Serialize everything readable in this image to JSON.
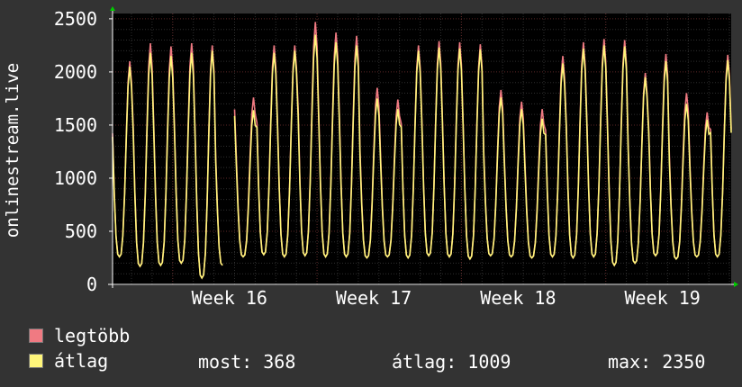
{
  "chart_data": {
    "type": "line",
    "ylabel": "onlinestream.live",
    "yticks": [
      0,
      500,
      1000,
      1500,
      2000,
      2500
    ],
    "ylim": [
      0,
      2550
    ],
    "week_ticks": [
      "Week 16",
      "Week 17",
      "Week 18",
      "Week 19"
    ],
    "x_hour_range": [
      0,
      720
    ],
    "days": 30,
    "daily_peaks_max": [
      2100,
      2270,
      2240,
      2270,
      2250,
      1820,
      1760,
      2250,
      2250,
      2470,
      2370,
      2340,
      1850,
      1740,
      2250,
      2290,
      2280,
      2260,
      1830,
      1720,
      1650,
      2150,
      2280,
      2310,
      2300,
      1990,
      2170,
      1800,
      1620,
      2160
    ],
    "daily_peaks_avg": [
      2050,
      2180,
      2150,
      2180,
      2200,
      1750,
      1640,
      2180,
      2200,
      2350,
      2280,
      2250,
      1750,
      1650,
      2200,
      2230,
      2220,
      2210,
      1760,
      1650,
      1560,
      2080,
      2220,
      2250,
      2240,
      1950,
      2100,
      1700,
      1550,
      2110
    ],
    "daily_troughs": [
      260,
      170,
      180,
      200,
      60,
      180,
      260,
      280,
      260,
      270,
      260,
      260,
      250,
      260,
      250,
      270,
      260,
      240,
      270,
      260,
      250,
      260,
      250,
      260,
      180,
      200,
      270,
      240,
      260,
      260
    ],
    "gap_days": [
      5
    ],
    "series": [
      {
        "name": "legtöbb",
        "color": "#f07a82"
      },
      {
        "name": "átlag",
        "color": "#fff67a"
      }
    ]
  },
  "legend": {
    "max_label": "legtöbb",
    "avg_label": "átlag",
    "now": "most: 368",
    "mean": "átlag: 1009",
    "max": "max: 2350"
  }
}
